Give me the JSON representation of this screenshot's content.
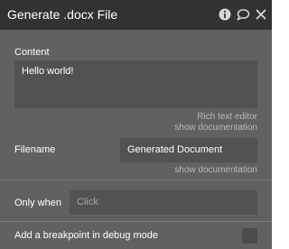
{
  "window": {
    "title": "Generate .docx File",
    "icons": [
      "info-icon",
      "comment-icon",
      "close-icon"
    ]
  },
  "content_field": {
    "label": "Content",
    "value": "Hello world!",
    "editor_hint": "Rich text editor",
    "doc_link": "show documentation"
  },
  "filename_field": {
    "label": "Filename",
    "value": "Generated Document",
    "doc_link": "show documentation"
  },
  "only_when": {
    "label": "Only when",
    "placeholder": "Click"
  },
  "breakpoint": {
    "label": "Add a breakpoint in debug mode",
    "checked": false
  },
  "colors": {
    "panel_bg": "#616161",
    "title_bar_bg": "#323232",
    "field_bg": "#525252"
  }
}
